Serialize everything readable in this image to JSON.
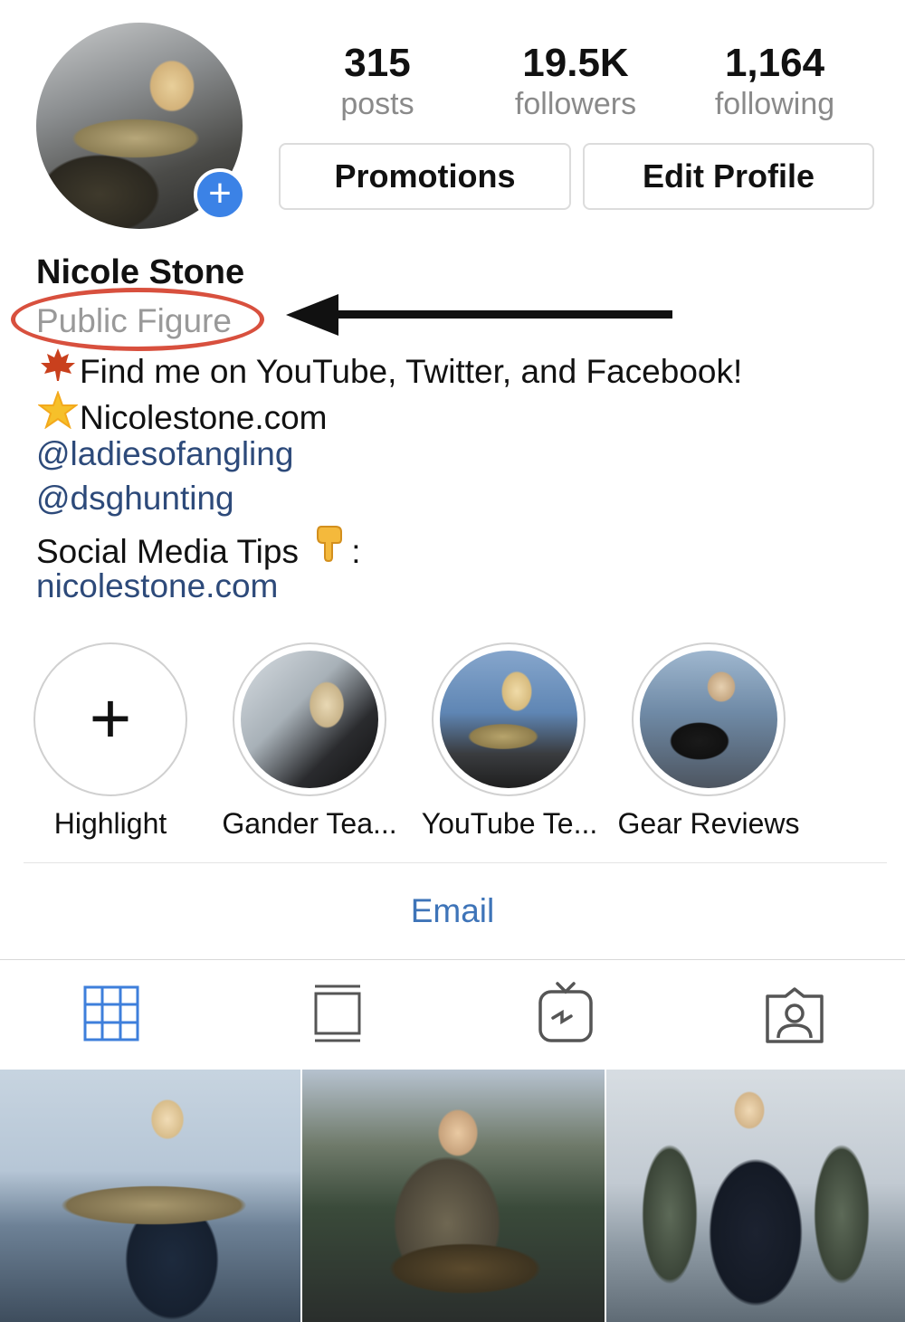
{
  "profile": {
    "name": "Nicole Stone",
    "category": "Public Figure"
  },
  "stats": [
    {
      "value": "315",
      "label": "posts"
    },
    {
      "value": "19.5K",
      "label": "followers"
    },
    {
      "value": "1,164",
      "label": "following"
    }
  ],
  "buttons": {
    "promotions": "Promotions",
    "edit_profile": "Edit Profile"
  },
  "bio": {
    "line1_icon": "maple-leaf-icon",
    "line1": "Find me on YouTube, Twitter, and Facebook!",
    "line2_icon": "star-icon",
    "line2": "Nicolestone.com",
    "mention1": "@ladiesofangling",
    "mention2": "@dsghunting",
    "tips": "Social Media Tips",
    "tips_icon": "pointing-down-icon",
    "tips_suffix": ":",
    "website": "nicolestone.com"
  },
  "highlights": [
    {
      "label": "Highlight"
    },
    {
      "label": "Gander Tea..."
    },
    {
      "label": "YouTube Te..."
    },
    {
      "label": "Gear Reviews"
    }
  ],
  "contact": {
    "email": "Email"
  },
  "tabs": [
    "grid-icon",
    "feed-icon",
    "igtv-icon",
    "tagged-icon"
  ],
  "colors": {
    "accent_blue": "#3b82e6",
    "link": "#2d4a7a",
    "annotation_red": "#d8503e"
  }
}
